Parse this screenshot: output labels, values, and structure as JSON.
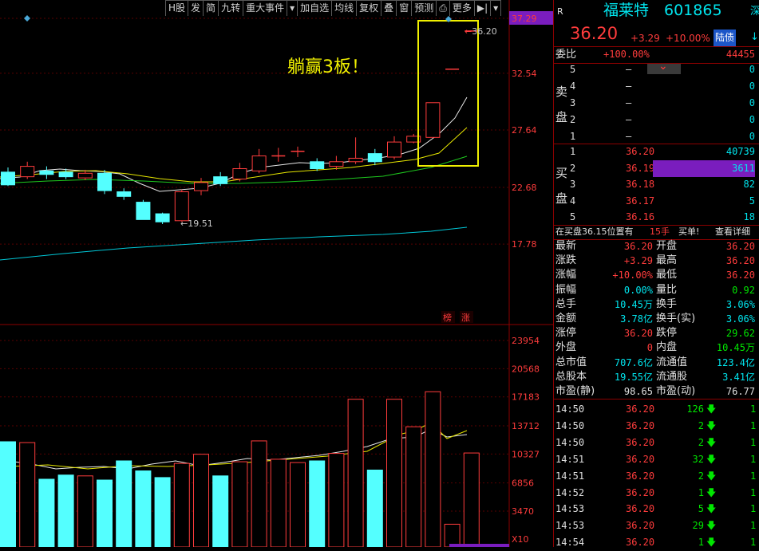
{
  "toolbar": {
    "items": [
      "H股",
      "发",
      "简",
      "九转",
      "重大事件",
      "▾",
      "加自选",
      "均线",
      "复权",
      "叠",
      "窗",
      "预测",
      "⎙",
      "更多",
      "▶|",
      "▾"
    ]
  },
  "chart": {
    "annotation": "躺赢3板！",
    "price_axis": [
      "37.29",
      "32.54",
      "27.64",
      "22.68",
      "17.78"
    ],
    "volume_axis": [
      "23954",
      "20568",
      "17183",
      "13712",
      "10327",
      "6856",
      "3470",
      "X10"
    ],
    "high_label": "36.20",
    "low_label": "19.51",
    "tags": [
      "榜",
      "涨"
    ]
  },
  "header": {
    "code_prefix": "R",
    "name": "福莱特",
    "code": "601865",
    "side": "深",
    "price": "36.20",
    "change": "+3.29",
    "pct": "+10.00%",
    "badge": "陆债",
    "side2": "↓"
  },
  "commission": {
    "label": "委比",
    "ratio": "+100.00%",
    "diff": "44455"
  },
  "sell": {
    "label": [
      "卖",
      "盘"
    ],
    "rows": [
      {
        "lvl": "5",
        "price": "—",
        "vol": "0"
      },
      {
        "lvl": "4",
        "price": "—",
        "vol": "0"
      },
      {
        "lvl": "3",
        "price": "—",
        "vol": "0"
      },
      {
        "lvl": "2",
        "price": "—",
        "vol": "0"
      },
      {
        "lvl": "1",
        "price": "—",
        "vol": "0"
      }
    ]
  },
  "buy": {
    "label": [
      "买",
      "盘"
    ],
    "rows": [
      {
        "lvl": "1",
        "price": "36.20",
        "vol": "40739"
      },
      {
        "lvl": "2",
        "price": "36.19",
        "vol": "3611"
      },
      {
        "lvl": "3",
        "price": "36.18",
        "vol": "82"
      },
      {
        "lvl": "4",
        "price": "36.17",
        "vol": "5"
      },
      {
        "lvl": "5",
        "price": "36.16",
        "vol": "18"
      }
    ]
  },
  "notice": {
    "text": "在买盘36.15位置有",
    "hand": "15手",
    "buy": "买单!",
    "detail": "查看详细"
  },
  "stats": [
    {
      "k1": "最新",
      "v1": "36.20",
      "c1": "r",
      "k2": "开盘",
      "v2": "36.20",
      "c2": "r"
    },
    {
      "k1": "涨跌",
      "v1": "+3.29",
      "c1": "r",
      "k2": "最高",
      "v2": "36.20",
      "c2": "r"
    },
    {
      "k1": "涨幅",
      "v1": "+10.00%",
      "c1": "r",
      "k2": "最低",
      "v2": "36.20",
      "c2": "r"
    },
    {
      "k1": "振幅",
      "v1": "0.00%",
      "c1": "c",
      "k2": "量比",
      "v2": "0.92",
      "c2": "g"
    },
    {
      "k1": "总手",
      "v1": "10.45万",
      "c1": "c",
      "k2": "换手",
      "v2": "3.06%",
      "c2": "c"
    },
    {
      "k1": "金额",
      "v1": "3.78亿",
      "c1": "c",
      "k2": "换手(实)",
      "v2": "3.06%",
      "c2": "c"
    },
    {
      "k1": "涨停",
      "v1": "36.20",
      "c1": "r",
      "k2": "跌停",
      "v2": "29.62",
      "c2": "g"
    },
    {
      "k1": "外盘",
      "v1": "0",
      "c1": "r",
      "k2": "内盘",
      "v2": "10.45万",
      "c2": "g"
    },
    {
      "k1": "总市值",
      "v1": "707.6亿",
      "c1": "c",
      "k2": "流通值",
      "v2": "123.4亿",
      "c2": "c"
    },
    {
      "k1": "总股本",
      "v1": "19.55亿",
      "c1": "c",
      "k2": "流通股",
      "v2": "3.41亿",
      "c2": "c"
    },
    {
      "k1": "市盈(静)",
      "v1": "98.65",
      "c1": "w",
      "k2": "市盈(动)",
      "v2": "76.77",
      "c2": "w"
    }
  ],
  "ticks": [
    {
      "t": "14:50",
      "p": "36.20",
      "v": "126",
      "n": "1"
    },
    {
      "t": "14:50",
      "p": "36.20",
      "v": "2",
      "n": "1"
    },
    {
      "t": "14:50",
      "p": "36.20",
      "v": "2",
      "n": "1"
    },
    {
      "t": "14:51",
      "p": "36.20",
      "v": "32",
      "n": "1"
    },
    {
      "t": "14:51",
      "p": "36.20",
      "v": "2",
      "n": "1"
    },
    {
      "t": "14:52",
      "p": "36.20",
      "v": "1",
      "n": "1"
    },
    {
      "t": "14:53",
      "p": "36.20",
      "v": "5",
      "n": "1"
    },
    {
      "t": "14:53",
      "p": "36.20",
      "v": "29",
      "n": "1"
    },
    {
      "t": "14:54",
      "p": "36.20",
      "v": "1",
      "n": "1"
    }
  ],
  "chart_data": {
    "type": "candlestick",
    "price_ticks": [
      37.29,
      32.54,
      27.64,
      22.68,
      17.78
    ],
    "volume_ticks": [
      23954,
      20568,
      17183,
      13712,
      10327,
      6856,
      3470
    ],
    "candles": [
      {
        "o": 24.0,
        "c": 22.9,
        "h": 24.4,
        "l": 22.8,
        "v": 11800
      },
      {
        "o": 23.6,
        "c": 24.5,
        "h": 24.9,
        "l": 23.4,
        "v": 11700
      },
      {
        "o": 24.1,
        "c": 23.8,
        "h": 24.5,
        "l": 23.4,
        "v": 7300
      },
      {
        "o": 24.0,
        "c": 23.6,
        "h": 24.3,
        "l": 23.4,
        "v": 7800
      },
      {
        "o": 23.5,
        "c": 23.9,
        "h": 24.2,
        "l": 23.3,
        "v": 7700
      },
      {
        "o": 23.9,
        "c": 22.4,
        "h": 24.2,
        "l": 22.1,
        "v": 7200
      },
      {
        "o": 22.3,
        "c": 21.9,
        "h": 22.6,
        "l": 21.6,
        "v": 9500
      },
      {
        "o": 21.4,
        "c": 19.9,
        "h": 21.6,
        "l": 19.9,
        "v": 8300
      },
      {
        "o": 20.4,
        "c": 19.7,
        "h": 20.5,
        "l": 19.51,
        "v": 7500
      },
      {
        "o": 19.8,
        "c": 22.3,
        "h": 22.5,
        "l": 19.7,
        "v": 9200
      },
      {
        "o": 22.4,
        "c": 23.1,
        "h": 23.5,
        "l": 22.0,
        "v": 10300
      },
      {
        "o": 23.6,
        "c": 23.0,
        "h": 24.0,
        "l": 22.8,
        "v": 7700
      },
      {
        "o": 23.4,
        "c": 24.3,
        "h": 24.8,
        "l": 23.2,
        "v": 9400
      },
      {
        "o": 24.1,
        "c": 25.4,
        "h": 26.0,
        "l": 23.9,
        "v": 11900
      },
      {
        "o": 25.4,
        "c": 25.4,
        "h": 26.1,
        "l": 24.9,
        "v": 9700
      },
      {
        "o": 25.8,
        "c": 25.8,
        "h": 26.2,
        "l": 25.3,
        "v": 9300
      },
      {
        "o": 24.9,
        "c": 24.3,
        "h": 25.2,
        "l": 24.1,
        "v": 9500
      },
      {
        "o": 24.5,
        "c": 24.9,
        "h": 25.4,
        "l": 24.2,
        "v": 10400
      },
      {
        "o": 24.9,
        "c": 25.2,
        "h": 27.0,
        "l": 24.7,
        "v": 16900
      },
      {
        "o": 25.6,
        "c": 24.9,
        "h": 26.0,
        "l": 24.6,
        "v": 8400
      },
      {
        "o": 25.3,
        "c": 26.6,
        "h": 27.1,
        "l": 25.1,
        "v": 16900
      },
      {
        "o": 26.6,
        "c": 27.1,
        "h": 27.3,
        "l": 26.5,
        "v": 13600
      },
      {
        "o": 27.0,
        "c": 30.0,
        "h": 30.0,
        "l": 27.0,
        "v": 17800
      },
      {
        "o": 32.9,
        "c": 32.9,
        "h": 32.9,
        "l": 32.9,
        "v": 1900
      },
      {
        "o": 36.2,
        "c": 36.2,
        "h": 36.2,
        "l": 36.2,
        "v": 10450
      }
    ]
  }
}
